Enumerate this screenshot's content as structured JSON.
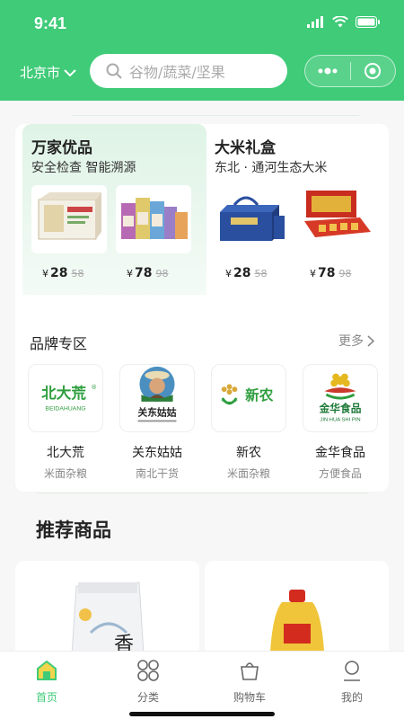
{
  "status": {
    "time": "9:41"
  },
  "header": {
    "city": "北京市",
    "search_placeholder": "谷物/蔬菜/坚果"
  },
  "promos": [
    {
      "title": "万家优品",
      "subtitle": "安全检查  智能溯源",
      "products": [
        {
          "price": "28",
          "old_price": "58"
        },
        {
          "price": "78",
          "old_price": "98"
        }
      ]
    },
    {
      "title": "大米礼盒",
      "subtitle": "东北 · 通河生态大米",
      "products": [
        {
          "price": "28",
          "old_price": "58"
        },
        {
          "price": "78",
          "old_price": "98"
        }
      ]
    }
  ],
  "currency": "¥",
  "brand_section": {
    "title": "品牌专区",
    "more": "更多",
    "brands": [
      {
        "name": "北大荒",
        "sub": "米面杂粮",
        "logo_text": "北大荒",
        "logo_sub": "BEIDAHUANG"
      },
      {
        "name": "关东姑姑",
        "sub": "南北干货",
        "logo_text": "关东姑姑"
      },
      {
        "name": "新农",
        "sub": "米面杂粮",
        "logo_text": "新农"
      },
      {
        "name": "金华食品",
        "sub": "方便食品",
        "logo_text": "金华食品",
        "logo_sub": "JIN HUA SHI PIN"
      }
    ]
  },
  "recommend": {
    "title": "推荐商品"
  },
  "tabbar": {
    "items": [
      {
        "label": "首页",
        "icon": "home-icon",
        "active": true
      },
      {
        "label": "分类",
        "icon": "category-icon",
        "active": false
      },
      {
        "label": "购物车",
        "icon": "cart-icon",
        "active": false
      },
      {
        "label": "我的",
        "icon": "user-icon",
        "active": false
      }
    ]
  },
  "colors": {
    "accent": "#3fcb78",
    "brand_green": "#2e9e3e"
  }
}
